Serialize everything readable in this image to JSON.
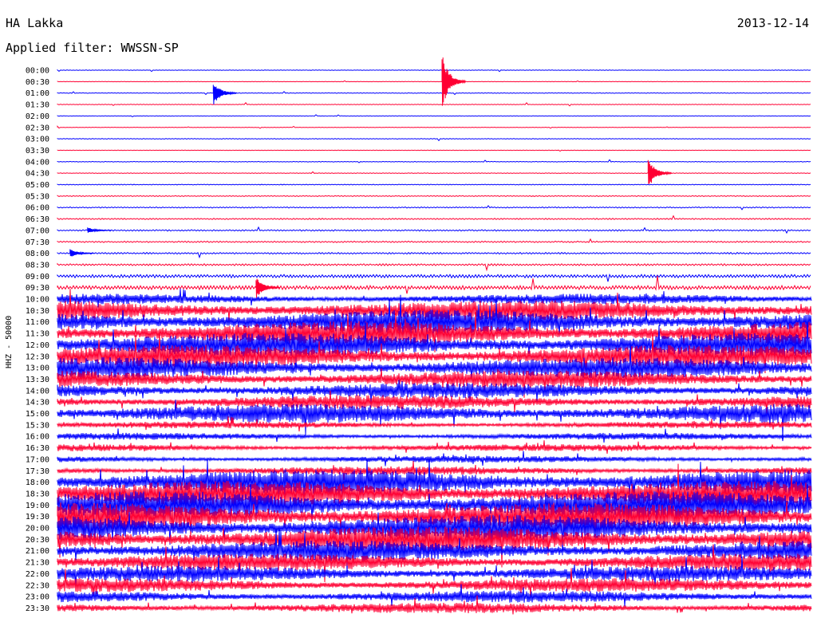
{
  "header": {
    "station": "HA Lakka",
    "date": "2013-12-14",
    "filter": "Applied filter: WWSSN-SP"
  },
  "chart_data": {
    "type": "line",
    "title": "HA Lakka",
    "date": "2013-12-14",
    "filter": "WWSSN-SP",
    "ylabel": "HHZ - 50000",
    "row_labels": [
      "00:00",
      "00:30",
      "01:00",
      "01:30",
      "02:00",
      "02:30",
      "03:00",
      "03:30",
      "04:00",
      "04:30",
      "05:00",
      "05:30",
      "06:00",
      "06:30",
      "07:00",
      "07:30",
      "08:00",
      "08:30",
      "09:00",
      "09:30",
      "10:00",
      "10:30",
      "11:00",
      "11:30",
      "12:00",
      "12:30",
      "13:00",
      "13:30",
      "14:00",
      "14:30",
      "15:00",
      "15:30",
      "16:00",
      "16:30",
      "17:00",
      "17:30",
      "18:00",
      "18:30",
      "19:00",
      "19:30",
      "20:00",
      "20:30",
      "21:00",
      "21:30",
      "22:00",
      "22:30",
      "23:00",
      "23:30"
    ],
    "series_colors": [
      "#0000ff",
      "#ff0033"
    ],
    "row_noise_level": [
      0.3,
      0.3,
      0.4,
      0.4,
      0.3,
      0.3,
      0.4,
      0.3,
      0.4,
      0.4,
      0.5,
      0.6,
      0.7,
      0.8,
      0.9,
      0.9,
      1.0,
      1.2,
      2,
      2.5,
      6,
      12,
      14,
      14,
      14,
      13,
      12,
      10,
      9,
      8,
      11,
      4,
      4,
      4,
      4,
      5,
      15,
      15,
      16,
      16,
      15,
      15,
      12,
      10,
      9,
      8,
      7,
      6
    ],
    "events": [
      {
        "row": 2,
        "minute": 6.2,
        "amplitude": 16,
        "color": "blue"
      },
      {
        "row": 1,
        "minute": 15.3,
        "amplitude": 35,
        "color": "red"
      },
      {
        "row": 9,
        "minute": 23.5,
        "amplitude": 20,
        "color": "red"
      },
      {
        "row": 19,
        "minute": 7.9,
        "amplitude": 14,
        "color": "red"
      },
      {
        "row": 16,
        "minute": 0.5,
        "amplitude": 6,
        "color": "blue"
      },
      {
        "row": 14,
        "minute": 1.2,
        "amplitude": 4,
        "color": "blue"
      }
    ]
  }
}
